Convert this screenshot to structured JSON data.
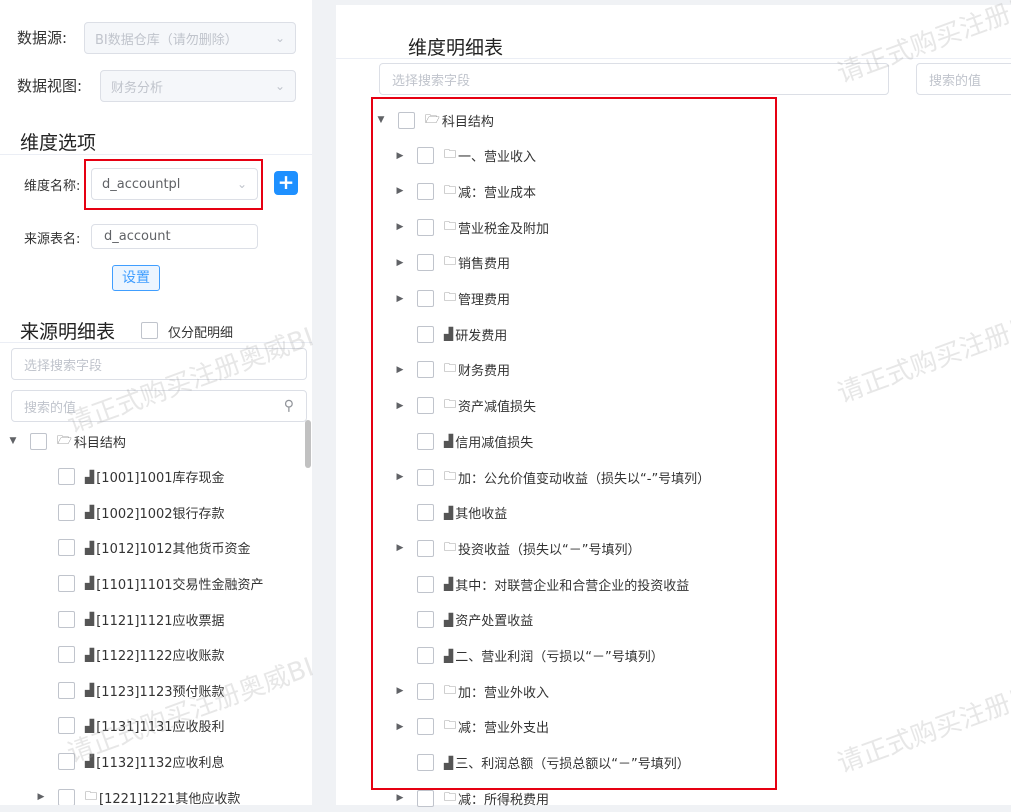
{
  "left": {
    "datasource_label": "数据源:",
    "datasource_value": "BI数据仓库（请勿删除）",
    "dataview_label": "数据视图:",
    "dataview_value": "财务分析",
    "dimension_section_title": "维度选项",
    "dimension_name_label": "维度名称:",
    "dimension_name_value": "d_accountpl",
    "source_table_label": "来源表名:",
    "source_table_value": "d_account",
    "set_button": "设置",
    "source_detail_title": "来源明细表",
    "only_assigned_label": "仅分配明细",
    "search_field_placeholder": "选择搜索字段",
    "search_value_placeholder": "搜索的值",
    "tree": [
      {
        "label": "科目结构",
        "icon": "folder-open-icon",
        "expand": "expanded"
      },
      {
        "label": "[1001]1001库存现金",
        "icon": "chart-icon",
        "expand": "none"
      },
      {
        "label": "[1002]1002银行存款",
        "icon": "chart-icon",
        "expand": "none"
      },
      {
        "label": "[1012]1012其他货币资金",
        "icon": "chart-icon",
        "expand": "none"
      },
      {
        "label": "[1101]1101交易性金融资产",
        "icon": "chart-icon",
        "expand": "none"
      },
      {
        "label": "[1121]1121应收票据",
        "icon": "chart-icon",
        "expand": "none"
      },
      {
        "label": "[1122]1122应收账款",
        "icon": "chart-icon",
        "expand": "none"
      },
      {
        "label": "[1123]1123预付账款",
        "icon": "chart-icon",
        "expand": "none"
      },
      {
        "label": "[1131]1131应收股利",
        "icon": "chart-icon",
        "expand": "none"
      },
      {
        "label": "[1132]1132应收利息",
        "icon": "chart-icon",
        "expand": "none"
      },
      {
        "label": "[1221]1221其他应收款",
        "icon": "folder-icon",
        "expand": "collapsed"
      }
    ]
  },
  "right": {
    "title": "维度明细表",
    "search_field_placeholder": "选择搜索字段",
    "search_value_placeholder": "搜索的值",
    "tree": [
      {
        "label": "科目结构",
        "icon": "folder-open-icon",
        "expand": "expanded"
      },
      {
        "label": "一、营业收入",
        "icon": "folder-icon",
        "expand": "collapsed"
      },
      {
        "label": "减：营业成本",
        "icon": "folder-icon",
        "expand": "collapsed"
      },
      {
        "label": "营业税金及附加",
        "icon": "folder-icon",
        "expand": "collapsed"
      },
      {
        "label": "销售费用",
        "icon": "folder-icon",
        "expand": "collapsed"
      },
      {
        "label": "管理费用",
        "icon": "folder-icon",
        "expand": "collapsed"
      },
      {
        "label": "研发费用",
        "icon": "chart-icon",
        "expand": "none"
      },
      {
        "label": "财务费用",
        "icon": "folder-icon",
        "expand": "collapsed"
      },
      {
        "label": "资产减值损失",
        "icon": "folder-icon",
        "expand": "collapsed"
      },
      {
        "label": "信用减值损失",
        "icon": "chart-icon",
        "expand": "none"
      },
      {
        "label": "加：公允价值变动收益（损失以“-”号填列）",
        "icon": "folder-icon",
        "expand": "collapsed"
      },
      {
        "label": "其他收益",
        "icon": "chart-icon",
        "expand": "none"
      },
      {
        "label": "投资收益（损失以“－”号填列）",
        "icon": "folder-icon",
        "expand": "collapsed"
      },
      {
        "label": "其中：对联营企业和合营企业的投资收益",
        "icon": "chart-icon",
        "expand": "none"
      },
      {
        "label": "资产处置收益",
        "icon": "chart-icon",
        "expand": "none"
      },
      {
        "label": "二、营业利润（亏损以“－”号填列）",
        "icon": "chart-icon",
        "expand": "none"
      },
      {
        "label": "加：营业外收入",
        "icon": "folder-icon",
        "expand": "collapsed"
      },
      {
        "label": "减：营业外支出",
        "icon": "folder-icon",
        "expand": "collapsed"
      },
      {
        "label": "三、利润总额（亏损总额以“－”号填列）",
        "icon": "chart-icon",
        "expand": "none"
      },
      {
        "label": "减：所得税费用",
        "icon": "folder-icon",
        "expand": "collapsed"
      }
    ]
  },
  "watermark": "请正式购买注册奥威BI",
  "colors": {
    "accent": "#409eff",
    "plus_button": "#1e90ff",
    "highlight": "#e60012"
  }
}
